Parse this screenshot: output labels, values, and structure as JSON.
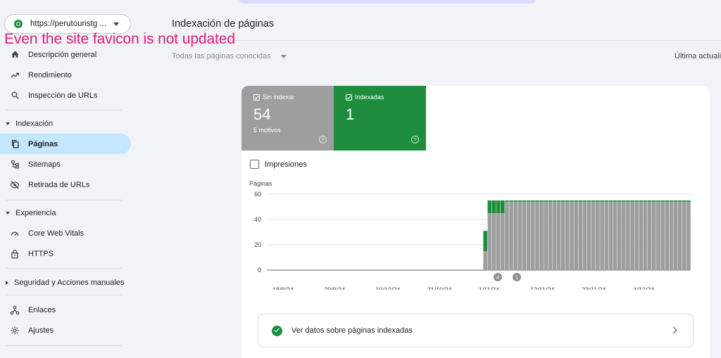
{
  "property": {
    "url": "https://perutouristg ..."
  },
  "annotation": "Even the site favicon is not updated",
  "nav": {
    "overview": "Descripción general",
    "performance": "Rendimiento",
    "url_inspection": "Inspección de URLs",
    "indexing_header": "Indexación",
    "pages": "Páginas",
    "sitemaps": "Sitemaps",
    "removals": "Retirada de URLs",
    "experience_header": "Experiencia",
    "cwv": "Core Web Vitals",
    "https": "HTTPS",
    "security_header": "Seguridad y Acciones manuales",
    "links": "Enlaces",
    "settings": "Ajustes"
  },
  "main": {
    "title": "Indexación de páginas",
    "filter": "Todas las páginas conocidas",
    "last_updated": "Última actuali"
  },
  "tiles": {
    "unindexed": {
      "label": "Sin indexar",
      "value": "54",
      "sub": "5 motivos",
      "help": "?"
    },
    "indexed": {
      "label": "Indexadas",
      "value": "1",
      "help": "?"
    }
  },
  "impressions_label": "Impresiones",
  "view_indexed_label": "Ver datos sobre páginas indexadas",
  "colors": {
    "unindexed": "#9e9e9e",
    "indexed": "#1e8e3e",
    "accent": "#c2e7ff",
    "annotation": "#e8177f"
  },
  "chart_data": {
    "type": "bar",
    "stacked": true,
    "ylabel": "Páginas",
    "ylim": [
      0,
      60
    ],
    "y_ticks": [
      "0",
      "20",
      "40",
      "60"
    ],
    "x_tick_labels": [
      "18/9/24",
      "29/9/24",
      "10/10/24",
      "21/10/24",
      "1/11/24",
      "12/11/24",
      "23/11/24",
      "4/12/24"
    ],
    "annotations": [
      "4",
      "1"
    ],
    "series": [
      {
        "name": "Sin indexar",
        "color": "#9e9e9e",
        "values": [
          0,
          0,
          0,
          0,
          0,
          0,
          0,
          0,
          0,
          0,
          0,
          0,
          0,
          0,
          0,
          0,
          0,
          0,
          0,
          0,
          0,
          0,
          0,
          0,
          0,
          0,
          0,
          0,
          0,
          0,
          0,
          0,
          0,
          0,
          0,
          0,
          0,
          0,
          0,
          0,
          0,
          0,
          0,
          0,
          0,
          0,
          0,
          0,
          0,
          0,
          15,
          45,
          45,
          45,
          45,
          54,
          54,
          54,
          54,
          54,
          54,
          54,
          54,
          54,
          54,
          54,
          54,
          54,
          54,
          54,
          54,
          54,
          54,
          54,
          54,
          54,
          54,
          54,
          54,
          54,
          54,
          54,
          54,
          54,
          54,
          54,
          54,
          54,
          54,
          54,
          54,
          54,
          54,
          54,
          54,
          54,
          54,
          54
        ]
      },
      {
        "name": "Indexadas",
        "color": "#1e8e3e",
        "values": [
          0,
          0,
          0,
          0,
          0,
          0,
          0,
          0,
          0,
          0,
          0,
          0,
          0,
          0,
          0,
          0,
          0,
          0,
          0,
          0,
          0,
          0,
          0,
          0,
          0,
          0,
          0,
          0,
          0,
          0,
          0,
          0,
          0,
          0,
          0,
          0,
          0,
          0,
          0,
          0,
          0,
          0,
          0,
          0,
          0,
          0,
          0,
          0,
          0,
          0,
          16,
          10,
          10,
          10,
          10,
          1,
          1,
          1,
          1,
          1,
          1,
          1,
          1,
          1,
          1,
          1,
          1,
          1,
          1,
          1,
          1,
          1,
          1,
          1,
          1,
          1,
          1,
          1,
          1,
          1,
          1,
          1,
          1,
          1,
          1,
          1,
          1,
          1,
          1,
          1,
          1,
          1,
          1,
          1,
          1,
          1,
          1,
          1
        ]
      }
    ]
  }
}
